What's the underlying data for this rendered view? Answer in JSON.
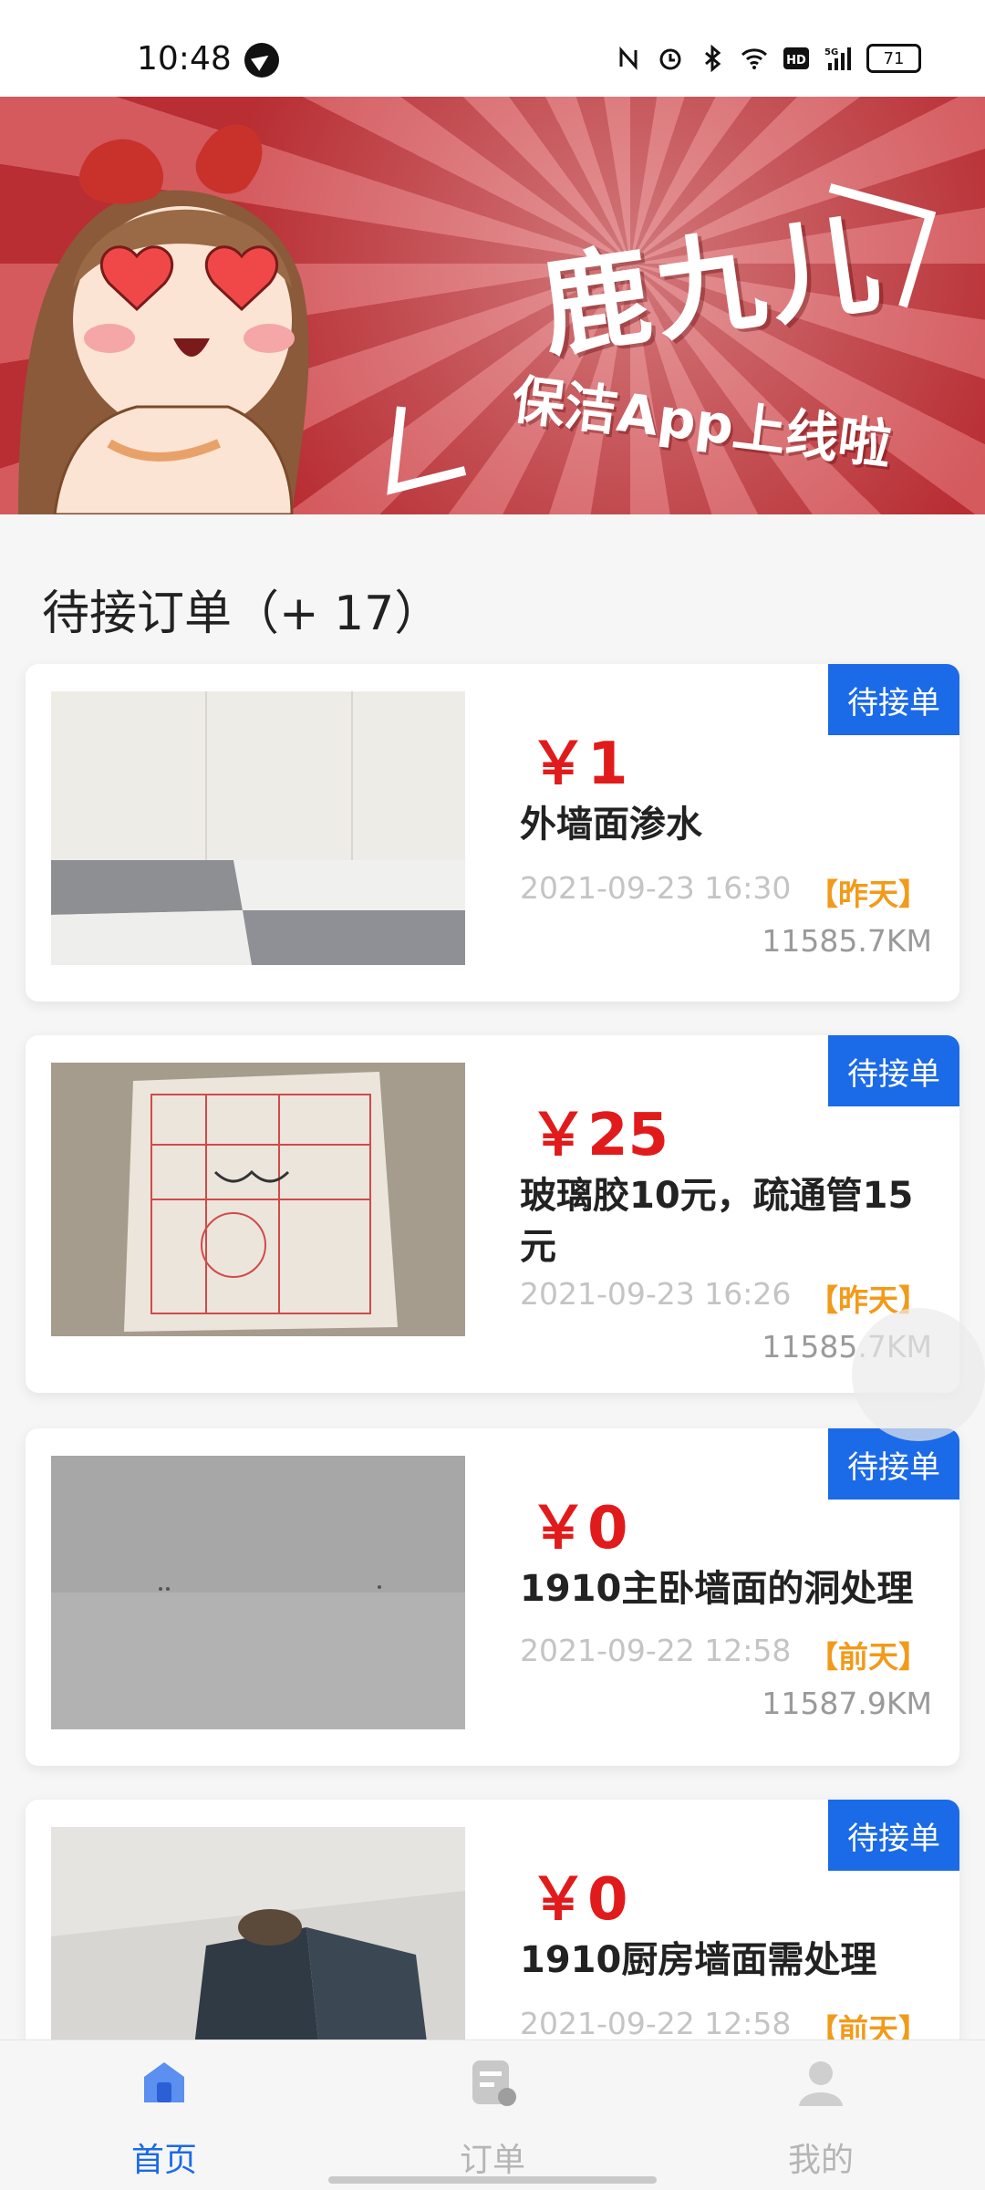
{
  "status_bar": {
    "time": "10:48",
    "battery": "71"
  },
  "banner": {
    "title": "鹿九儿",
    "subtitle": "保洁App上线啦"
  },
  "section_title": "待接订单（+ 17）",
  "orders": [
    {
      "tag": "待接单",
      "price": "￥1",
      "title": "外墙面渗水",
      "time": "2021-09-23 16:30",
      "day": "【昨天】",
      "distance": "11585.7KM"
    },
    {
      "tag": "待接单",
      "price": "￥25",
      "title": "玻璃胶10元，疏通管15元",
      "time": "2021-09-23 16:26",
      "day": "【昨天】",
      "distance": "11585.7KM"
    },
    {
      "tag": "待接单",
      "price": "￥0",
      "title": "1910主卧墙面的洞处理",
      "time": "2021-09-22 12:58",
      "day": "【前天】",
      "distance": "11587.9KM"
    },
    {
      "tag": "待接单",
      "price": "￥0",
      "title": "1910厨房墙面需处理",
      "time": "2021-09-22 12:58",
      "day": "【前天】",
      "distance": ""
    }
  ],
  "nav": {
    "items": [
      {
        "label": "首页",
        "icon": "home-icon",
        "active": true
      },
      {
        "label": "订单",
        "icon": "order-icon",
        "active": false
      },
      {
        "label": "我的",
        "icon": "profile-icon",
        "active": false
      }
    ],
    "active_color": "#1b6ae8",
    "inactive_color": "#b5b5b5"
  },
  "colors": {
    "accent": "#1b6ae8",
    "price": "#e11b1b",
    "day": "#f29a1a"
  }
}
